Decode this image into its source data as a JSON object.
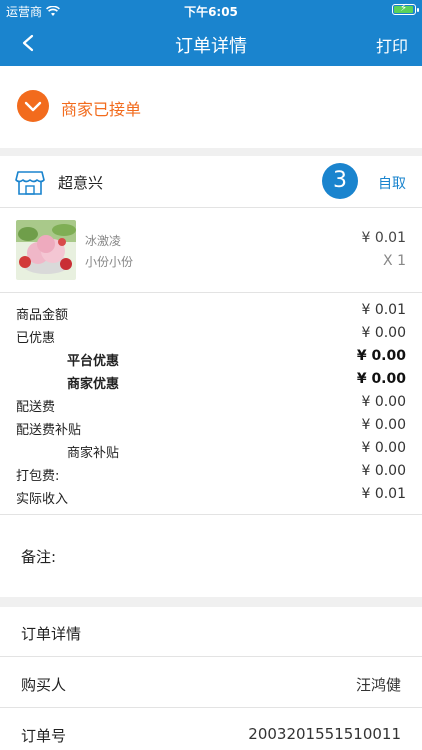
{
  "status_bar": {
    "carrier": "运营商",
    "time": "下午6:05",
    "battery_level": 0.9,
    "battery_color": "#5ad25a"
  },
  "nav": {
    "title": "订单详情",
    "print_label": "打印",
    "back_icon": "chevron-left-icon"
  },
  "order_status": {
    "label": "商家已接单",
    "icon": "check-circle-icon",
    "color": "#f26b1d"
  },
  "store": {
    "name": "超意兴",
    "icon": "storefront-icon",
    "order_number": "3",
    "pickup_label": "自取"
  },
  "item": {
    "name": "冰激凌",
    "spec": "小份小份",
    "price": "¥ 0.01",
    "quantity": "X 1"
  },
  "fees": [
    {
      "label": "商品金额",
      "value": "¥ 0.01"
    },
    {
      "label": "已优惠",
      "value": "¥ 0.00"
    },
    {
      "label": "平台优惠",
      "value": "¥ 0.00"
    },
    {
      "label": "商家优惠",
      "value": "¥ 0.00"
    },
    {
      "label": "配送费",
      "value": "¥ 0.00"
    },
    {
      "label": "配送费补贴",
      "value": "¥ 0.00"
    },
    {
      "label": "商家补贴",
      "value": "¥ 0.00"
    },
    {
      "label": "打包费:",
      "value": "¥ 0.00"
    },
    {
      "label": "实际收入",
      "value": "¥ 0.01"
    }
  ],
  "note": {
    "label": "备注:"
  },
  "details": {
    "title": "订单详情",
    "buyer_label": "购买人",
    "buyer_value": "汪鸿健",
    "order_id_label": "订单号",
    "order_id_value": "2003201551510011"
  },
  "colors": {
    "primary": "#1a84ce",
    "accent": "#f26b1d"
  }
}
